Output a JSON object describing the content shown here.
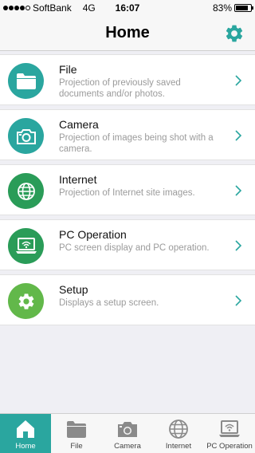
{
  "status_bar": {
    "carrier": "SoftBank",
    "network": "4G",
    "time": "16:07",
    "battery_percent": "83%",
    "battery_level": 0.83,
    "signal_bars": 4
  },
  "header": {
    "title": "Home",
    "settings_icon": "gear-icon"
  },
  "menu": {
    "items": [
      {
        "title": "File",
        "description": "Projection of previously saved documents and/or photos.",
        "icon": "folder-icon",
        "color": "#2aa69f"
      },
      {
        "title": "Camera",
        "description": "Projection of images being shot with a camera.",
        "icon": "camera-icon",
        "color": "#2aa69f"
      },
      {
        "title": "Internet",
        "description": "Projection of Internet site images.",
        "icon": "globe-icon",
        "color": "#2a9c58"
      },
      {
        "title": "PC Operation",
        "description": "PC screen display and PC operation.",
        "icon": "laptop-wifi-icon",
        "color": "#2a9c58"
      },
      {
        "title": "Setup",
        "description": "Displays a setup screen.",
        "icon": "gear-icon",
        "color": "#62b84a"
      }
    ]
  },
  "tab_bar": {
    "tabs": [
      {
        "label": "Home",
        "icon": "house-icon",
        "active": true
      },
      {
        "label": "File",
        "icon": "folder-icon",
        "active": false
      },
      {
        "label": "Camera",
        "icon": "camera-icon",
        "active": false
      },
      {
        "label": "Internet",
        "icon": "globe-icon",
        "active": false
      },
      {
        "label": "PC Operation",
        "icon": "laptop-wifi-icon",
        "active": false
      }
    ]
  },
  "colors": {
    "accent": "#2aa69f",
    "chevron": "#2aa69f",
    "tab_icon_inactive": "#8a8a8a"
  }
}
